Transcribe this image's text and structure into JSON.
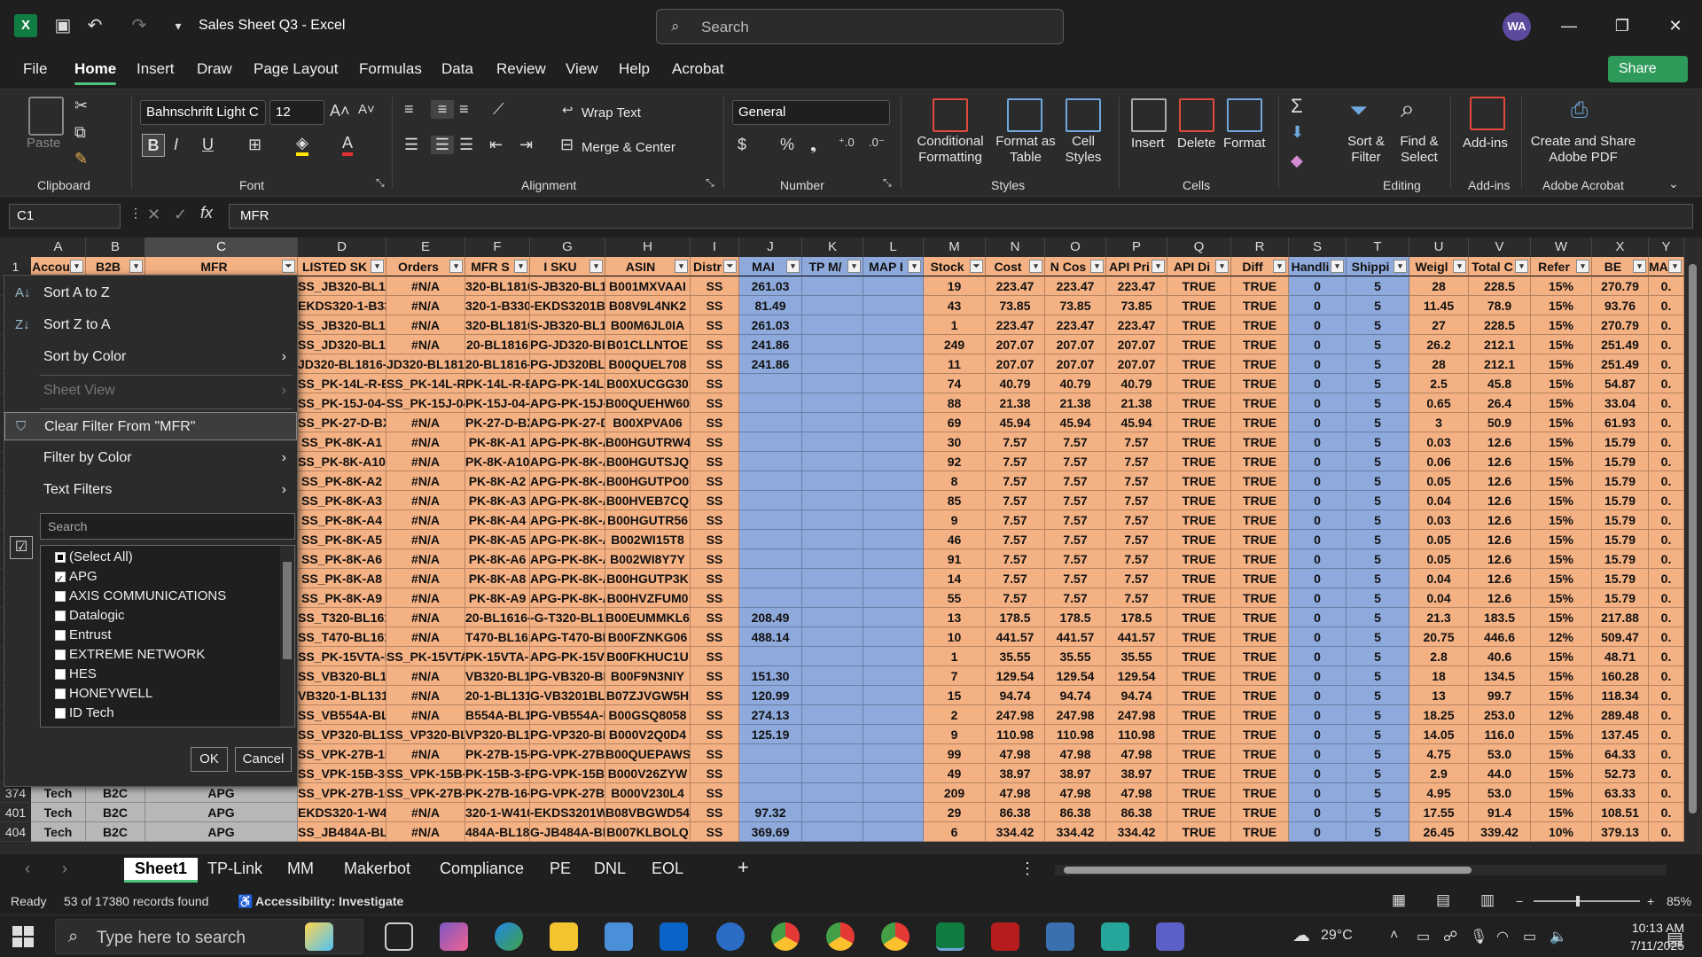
{
  "title_bar": {
    "document_title": "Sales Sheet Q3 - Excel",
    "search_placeholder": "Search",
    "user_initials": "WA"
  },
  "menu_tabs": [
    "File",
    "Home",
    "Insert",
    "Draw",
    "Page Layout",
    "Formulas",
    "Data",
    "Review",
    "View",
    "Help",
    "Acrobat"
  ],
  "share_label": "Share",
  "ribbon": {
    "clipboard": {
      "paste": "Paste",
      "label": "Clipboard"
    },
    "font": {
      "name": "Bahnschrift Light C",
      "size": "12",
      "label": "Font"
    },
    "alignment": {
      "wrap": "Wrap Text",
      "merge": "Merge & Center",
      "label": "Alignment"
    },
    "number": {
      "format": "General",
      "label": "Number"
    },
    "styles": {
      "conditional": "Conditional Formatting",
      "format_table": "Format as Table",
      "cell_styles": "Cell Styles",
      "label": "Styles"
    },
    "cells": {
      "insert": "Insert",
      "delete": "Delete",
      "format": "Format",
      "label": "Cells"
    },
    "editing": {
      "sort": "Sort & Filter",
      "find": "Find & Select",
      "label": "Editing"
    },
    "addins": {
      "addins": "Add-ins",
      "label": "Add-ins"
    },
    "acrobat": {
      "create": "Create and Share Adobe PDF",
      "label": "Adobe Acrobat"
    }
  },
  "formula_bar": {
    "name_box": "C1",
    "formula": "MFR"
  },
  "columns": [
    "A",
    "B",
    "C",
    "D",
    "E",
    "F",
    "G",
    "H",
    "I",
    "J",
    "K",
    "L",
    "M",
    "N",
    "O",
    "P",
    "Q",
    "R",
    "S",
    "T",
    "U",
    "V",
    "W",
    "X",
    "Y"
  ],
  "header_row": [
    "Accou",
    "B2B",
    "MFR",
    "LISTED SK",
    "Orders",
    "MFR S",
    "I SKU",
    "ASIN",
    "Distr",
    "MAI",
    "TP M/",
    "MAP I",
    "Stock",
    "Cost",
    "N Cos",
    "API Pri",
    "API Di",
    "Diff",
    "Handli",
    "Shippi",
    "Weigl",
    "Total C",
    "Refer",
    "BE",
    "MAP"
  ],
  "rows": [
    {
      "D": "SS_JB320-BL1816-",
      "E": "#N/A",
      "F": "320-BL1816-",
      "G": "S-JB320-BL1816",
      "H": "B001MXVAAI",
      "I": "SS",
      "J": "261.03",
      "M": "19",
      "N": "223.47",
      "O": "223.47",
      "P": "223.47",
      "Q": "TRUE",
      "R": "TRUE",
      "S": "0",
      "T": "5",
      "U": "28",
      "V": "228.5",
      "W": "15%",
      "X": "270.79",
      "Y": "0."
    },
    {
      "D": "EKDS320-1-B330",
      "E": "#N/A",
      "F": "320-1-B330",
      "G": "-EKDS3201B330",
      "H": "B08V9L4NK2",
      "I": "SS",
      "J": "81.49",
      "M": "43",
      "N": "73.85",
      "O": "73.85",
      "P": "73.85",
      "Q": "TRUE",
      "R": "TRUE",
      "S": "0",
      "T": "5",
      "U": "11.45",
      "V": "78.9",
      "W": "15%",
      "X": "93.76",
      "Y": "0."
    },
    {
      "D": "SS_JB320-BL1816-",
      "E": "#N/A",
      "F": "320-BL1816-",
      "G": "S-JB320-BL1816",
      "H": "B00M6JL0IA",
      "I": "SS",
      "J": "261.03",
      "M": "1",
      "N": "223.47",
      "O": "223.47",
      "P": "223.47",
      "Q": "TRUE",
      "R": "TRUE",
      "S": "0",
      "T": "5",
      "U": "27",
      "V": "228.5",
      "W": "15%",
      "X": "270.79",
      "Y": "0."
    },
    {
      "D": "SS_JD320-BL1816",
      "E": "#N/A",
      "F": "20-BL1816",
      "G": "PG-JD320-BL1816",
      "H": "B01CLLNTOE",
      "I": "SS",
      "J": "241.86",
      "M": "249",
      "N": "207.07",
      "O": "207.07",
      "P": "207.07",
      "Q": "TRUE",
      "R": "TRUE",
      "S": "0",
      "T": "5",
      "U": "26.2",
      "V": "212.1",
      "W": "15%",
      "X": "251.49",
      "Y": "0."
    },
    {
      "D": "JD320-BL1816-C",
      "E": "JD320-BL1816-C",
      "F": "20-BL1816-",
      "G": "PG-JD320BL1816C",
      "H": "B00QUEL708",
      "I": "SS",
      "J": "241.86",
      "M": "11",
      "N": "207.07",
      "O": "207.07",
      "P": "207.07",
      "Q": "TRUE",
      "R": "TRUE",
      "S": "0",
      "T": "5",
      "U": "28",
      "V": "212.1",
      "W": "15%",
      "X": "251.49",
      "Y": "0."
    },
    {
      "D": "SS_PK-14L-R-BX",
      "E": "SS_PK-14L-R-BX",
      "F": "PK-14L-R-B",
      "G": "APG-PK-14L-R-B",
      "H": "B00XUCGG30",
      "I": "SS",
      "J": "",
      "M": "74",
      "N": "40.79",
      "O": "40.79",
      "P": "40.79",
      "Q": "TRUE",
      "R": "TRUE",
      "S": "0",
      "T": "5",
      "U": "2.5",
      "V": "45.8",
      "W": "15%",
      "X": "54.87",
      "Y": "0."
    },
    {
      "D": "SS_PK-15J-04-BX",
      "E": "SS_PK-15J-04-BX",
      "F": "PK-15J-04-B",
      "G": "APG-PK-15J-04-E",
      "H": "B00QUEHW60",
      "I": "SS",
      "J": "",
      "M": "88",
      "N": "21.38",
      "O": "21.38",
      "P": "21.38",
      "Q": "TRUE",
      "R": "TRUE",
      "S": "0",
      "T": "5",
      "U": "0.65",
      "V": "26.4",
      "W": "15%",
      "X": "33.04",
      "Y": "0."
    },
    {
      "D": "SS_PK-27-D-BX",
      "E": "#N/A",
      "F": "PK-27-D-BX",
      "G": "APG-PK-27-D-BX",
      "H": "B00XPVA06",
      "I": "SS",
      "J": "",
      "M": "69",
      "N": "45.94",
      "O": "45.94",
      "P": "45.94",
      "Q": "TRUE",
      "R": "TRUE",
      "S": "0",
      "T": "5",
      "U": "3",
      "V": "50.9",
      "W": "15%",
      "X": "61.93",
      "Y": "0."
    },
    {
      "D": "SS_PK-8K-A1",
      "E": "#N/A",
      "F": "PK-8K-A1",
      "G": "APG-PK-8K-A1",
      "H": "B00HGUTRW4",
      "I": "SS",
      "J": "",
      "M": "30",
      "N": "7.57",
      "O": "7.57",
      "P": "7.57",
      "Q": "TRUE",
      "R": "TRUE",
      "S": "0",
      "T": "5",
      "U": "0.03",
      "V": "12.6",
      "W": "15%",
      "X": "15.79",
      "Y": "0."
    },
    {
      "D": "SS_PK-8K-A10",
      "E": "#N/A",
      "F": "PK-8K-A10",
      "G": "APG-PK-8K-A10",
      "H": "B00HGUTSJQ",
      "I": "SS",
      "J": "",
      "M": "92",
      "N": "7.57",
      "O": "7.57",
      "P": "7.57",
      "Q": "TRUE",
      "R": "TRUE",
      "S": "0",
      "T": "5",
      "U": "0.06",
      "V": "12.6",
      "W": "15%",
      "X": "15.79",
      "Y": "0."
    },
    {
      "D": "SS_PK-8K-A2",
      "E": "#N/A",
      "F": "PK-8K-A2",
      "G": "APG-PK-8K-A2",
      "H": "B00HGUTPO0",
      "I": "SS",
      "J": "",
      "M": "8",
      "N": "7.57",
      "O": "7.57",
      "P": "7.57",
      "Q": "TRUE",
      "R": "TRUE",
      "S": "0",
      "T": "5",
      "U": "0.05",
      "V": "12.6",
      "W": "15%",
      "X": "15.79",
      "Y": "0."
    },
    {
      "D": "SS_PK-8K-A3",
      "E": "#N/A",
      "F": "PK-8K-A3",
      "G": "APG-PK-8K-A3",
      "H": "B00HVEB7CQ",
      "I": "SS",
      "J": "",
      "M": "85",
      "N": "7.57",
      "O": "7.57",
      "P": "7.57",
      "Q": "TRUE",
      "R": "TRUE",
      "S": "0",
      "T": "5",
      "U": "0.04",
      "V": "12.6",
      "W": "15%",
      "X": "15.79",
      "Y": "0."
    },
    {
      "D": "SS_PK-8K-A4",
      "E": "#N/A",
      "F": "PK-8K-A4",
      "G": "APG-PK-8K-A4",
      "H": "B00HGUTR56",
      "I": "SS",
      "J": "",
      "M": "9",
      "N": "7.57",
      "O": "7.57",
      "P": "7.57",
      "Q": "TRUE",
      "R": "TRUE",
      "S": "0",
      "T": "5",
      "U": "0.03",
      "V": "12.6",
      "W": "15%",
      "X": "15.79",
      "Y": "0."
    },
    {
      "D": "SS_PK-8K-A5",
      "E": "#N/A",
      "F": "PK-8K-A5",
      "G": "APG-PK-8K-A5",
      "H": "B002WI15T8",
      "I": "SS",
      "J": "",
      "M": "46",
      "N": "7.57",
      "O": "7.57",
      "P": "7.57",
      "Q": "TRUE",
      "R": "TRUE",
      "S": "0",
      "T": "5",
      "U": "0.05",
      "V": "12.6",
      "W": "15%",
      "X": "15.79",
      "Y": "0."
    },
    {
      "D": "SS_PK-8K-A6",
      "E": "#N/A",
      "F": "PK-8K-A6",
      "G": "APG-PK-8K-A6",
      "H": "B002WI8Y7Y",
      "I": "SS",
      "J": "",
      "M": "91",
      "N": "7.57",
      "O": "7.57",
      "P": "7.57",
      "Q": "TRUE",
      "R": "TRUE",
      "S": "0",
      "T": "5",
      "U": "0.05",
      "V": "12.6",
      "W": "15%",
      "X": "15.79",
      "Y": "0."
    },
    {
      "D": "SS_PK-8K-A8",
      "E": "#N/A",
      "F": "PK-8K-A8",
      "G": "APG-PK-8K-A8",
      "H": "B00HGUTP3K",
      "I": "SS",
      "J": "",
      "M": "14",
      "N": "7.57",
      "O": "7.57",
      "P": "7.57",
      "Q": "TRUE",
      "R": "TRUE",
      "S": "0",
      "T": "5",
      "U": "0.04",
      "V": "12.6",
      "W": "15%",
      "X": "15.79",
      "Y": "0."
    },
    {
      "D": "SS_PK-8K-A9",
      "E": "#N/A",
      "F": "PK-8K-A9",
      "G": "APG-PK-8K-A9",
      "H": "B00HVZFUM0",
      "I": "SS",
      "J": "",
      "M": "55",
      "N": "7.57",
      "O": "7.57",
      "P": "7.57",
      "Q": "TRUE",
      "R": "TRUE",
      "S": "0",
      "T": "5",
      "U": "0.04",
      "V": "12.6",
      "W": "15%",
      "X": "15.79",
      "Y": "0."
    },
    {
      "D": "SS_T320-BL1616-U",
      "E": "#N/A",
      "F": "20-BL1616-U",
      "G": "-G-T320-BL1616",
      "H": "B00EUMMKL6",
      "I": "SS",
      "J": "208.49",
      "M": "13",
      "N": "178.5",
      "O": "178.5",
      "P": "178.5",
      "Q": "TRUE",
      "R": "TRUE",
      "S": "0",
      "T": "5",
      "U": "21.3",
      "V": "183.5",
      "W": "15%",
      "X": "217.88",
      "Y": "0."
    },
    {
      "D": "SS_T470-BL1616",
      "E": "#N/A",
      "F": "T470-BL1616",
      "G": "APG-T470-BL161",
      "H": "B00FZNKG06",
      "I": "SS",
      "J": "488.14",
      "M": "10",
      "N": "441.57",
      "O": "441.57",
      "P": "441.57",
      "Q": "TRUE",
      "R": "TRUE",
      "S": "0",
      "T": "5",
      "U": "20.75",
      "V": "446.6",
      "W": "12%",
      "X": "509.47",
      "Y": "0."
    },
    {
      "D": "SS_PK-15VTA-BX",
      "E": "SS_PK-15VTA-BX",
      "F": "PK-15VTA-B",
      "G": "APG-PK-15VTA-B",
      "H": "B00FKHUC1U",
      "I": "SS",
      "J": "",
      "M": "1",
      "N": "35.55",
      "O": "35.55",
      "P": "35.55",
      "Q": "TRUE",
      "R": "TRUE",
      "S": "0",
      "T": "5",
      "U": "2.8",
      "V": "40.6",
      "W": "15%",
      "X": "48.71",
      "Y": "0."
    },
    {
      "D": "SS_VB320-BL1915",
      "E": "#N/A",
      "F": "VB320-BL191",
      "G": "PG-VB320-BL191",
      "H": "B00F9N3NIY",
      "I": "SS",
      "J": "151.30",
      "M": "7",
      "N": "129.54",
      "O": "129.54",
      "P": "129.54",
      "Q": "TRUE",
      "R": "TRUE",
      "S": "0",
      "T": "5",
      "U": "18",
      "V": "134.5",
      "W": "15%",
      "X": "160.28",
      "Y": "0."
    },
    {
      "D": "VB320-1-BL1313-",
      "E": "#N/A",
      "F": "20-1-BL1313",
      "G": "G-VB3201BL1313",
      "H": "B07ZJVGW5H",
      "I": "SS",
      "J": "120.99",
      "M": "15",
      "N": "94.74",
      "O": "94.74",
      "P": "94.74",
      "Q": "TRUE",
      "R": "TRUE",
      "S": "0",
      "T": "5",
      "U": "13",
      "V": "99.7",
      "W": "15%",
      "X": "118.34",
      "Y": "0."
    },
    {
      "D": "SS_VB554A-BL191",
      "E": "#N/A",
      "F": "B554A-BL19",
      "G": "PG-VB554A-BL19",
      "H": "B00GSQ8058",
      "I": "SS",
      "J": "274.13",
      "M": "2",
      "N": "247.98",
      "O": "247.98",
      "P": "247.98",
      "Q": "TRUE",
      "R": "TRUE",
      "S": "0",
      "T": "5",
      "U": "18.25",
      "V": "253.0",
      "W": "12%",
      "X": "289.48",
      "Y": "0."
    },
    {
      "D": "SS_VP320-BL1416",
      "E": "SS_VP320-BL1416",
      "F": "VP320-BL141",
      "G": "PG-VP320-BL141",
      "H": "B000V2Q0D4",
      "I": "SS",
      "J": "125.19",
      "M": "9",
      "N": "110.98",
      "O": "110.98",
      "P": "110.98",
      "Q": "TRUE",
      "R": "TRUE",
      "S": "0",
      "T": "5",
      "U": "14.05",
      "V": "116.0",
      "W": "15%",
      "X": "137.45",
      "Y": "0."
    },
    {
      "D": "SS_VPK-27B-15-B",
      "E": "#N/A",
      "F": "PK-27B-15-B",
      "G": "PG-VPK-27B-15-",
      "H": "B00QUEPAWS",
      "I": "SS",
      "J": "",
      "M": "99",
      "N": "47.98",
      "O": "47.98",
      "P": "47.98",
      "Q": "TRUE",
      "R": "TRUE",
      "S": "0",
      "T": "5",
      "U": "4.75",
      "V": "53.0",
      "W": "15%",
      "X": "64.33",
      "Y": "0."
    },
    {
      "D": "SS_VPK-15B-3-BX",
      "E": "SS_VPK-15B-3-BX",
      "F": "PK-15B-3-B",
      "G": "PG-VPK-15B-3-E",
      "H": "B000V26ZYW",
      "I": "SS",
      "J": "",
      "M": "49",
      "N": "38.97",
      "O": "38.97",
      "P": "38.97",
      "Q": "TRUE",
      "R": "TRUE",
      "S": "0",
      "T": "5",
      "U": "2.9",
      "V": "44.0",
      "W": "15%",
      "X": "52.73",
      "Y": "0."
    },
    {
      "num": "374",
      "A": "Tech",
      "B": "B2C",
      "C": "APG",
      "D": "SS_VPK-27B-16-B",
      "E": "SS_VPK-27B-16-BX",
      "F": "PK-27B-16-B",
      "G": "PG-VPK-27B-16-",
      "H": "B000V230L4",
      "I": "SS",
      "J": "",
      "M": "209",
      "N": "47.98",
      "O": "47.98",
      "P": "47.98",
      "Q": "TRUE",
      "R": "TRUE",
      "S": "0",
      "T": "5",
      "U": "4.95",
      "V": "53.0",
      "W": "15%",
      "X": "63.33",
      "Y": "0."
    },
    {
      "num": "401",
      "A": "Tech",
      "B": "B2C",
      "C": "APG",
      "D": "EKDS320-1-W410-",
      "E": "#N/A",
      "F": "320-1-W410",
      "G": "-EKDS3201W410",
      "H": "B08VBGWD54",
      "I": "SS",
      "J": "97.32",
      "M": "29",
      "N": "86.38",
      "O": "86.38",
      "P": "86.38",
      "Q": "TRUE",
      "R": "TRUE",
      "S": "0",
      "T": "5",
      "U": "17.55",
      "V": "91.4",
      "W": "15%",
      "X": "108.51",
      "Y": "0."
    },
    {
      "num": "404",
      "A": "Tech",
      "B": "B2C",
      "C": "APG",
      "D": "SS_JB484A-BL1816",
      "E": "#N/A",
      "F": "484A-BL1816",
      "G": "G-JB484A-BL181",
      "H": "B007KLBOLQ",
      "I": "SS",
      "J": "369.69",
      "M": "6",
      "N": "334.42",
      "O": "334.42",
      "P": "334.42",
      "Q": "TRUE",
      "R": "TRUE",
      "S": "0",
      "T": "5",
      "U": "26.45",
      "V": "339.42",
      "W": "10%",
      "X": "379.13",
      "Y": "0."
    }
  ],
  "filter_menu": {
    "sort_az": "Sort A to Z",
    "sort_za": "Sort Z to A",
    "sort_color": "Sort by Color",
    "sheet_view": "Sheet View",
    "clear_filter": "Clear Filter From \"MFR\"",
    "filter_color": "Filter by Color",
    "text_filters": "Text Filters",
    "search_placeholder": "Search",
    "options": [
      {
        "label": "(Select All)",
        "state": "part"
      },
      {
        "label": "APG",
        "state": "on"
      },
      {
        "label": "AXIS COMMUNICATIONS",
        "state": "off"
      },
      {
        "label": "Datalogic",
        "state": "off"
      },
      {
        "label": "Entrust",
        "state": "off"
      },
      {
        "label": "EXTREME NETWORK",
        "state": "off"
      },
      {
        "label": "HES",
        "state": "off"
      },
      {
        "label": "HONEYWELL",
        "state": "off"
      },
      {
        "label": "ID Tech",
        "state": "off"
      }
    ],
    "ok": "OK",
    "cancel": "Cancel"
  },
  "sheet_tabs": [
    "Sheet1",
    "TP-Link",
    "MM",
    "Makerbot",
    "Compliance",
    "PE",
    "DNL",
    "EOL"
  ],
  "status": {
    "ready": "Ready",
    "records": "53 of 17380 records found",
    "accessibility": "Accessibility: Investigate",
    "zoom": "85%"
  },
  "taskbar": {
    "search_placeholder": "Type here to search",
    "weather": "29°C",
    "time": "10:13 AM",
    "date": "7/11/2025"
  },
  "colors": {
    "orange": "#f4b183",
    "blue": "#8ea9db",
    "accent": "#4fc47c"
  }
}
